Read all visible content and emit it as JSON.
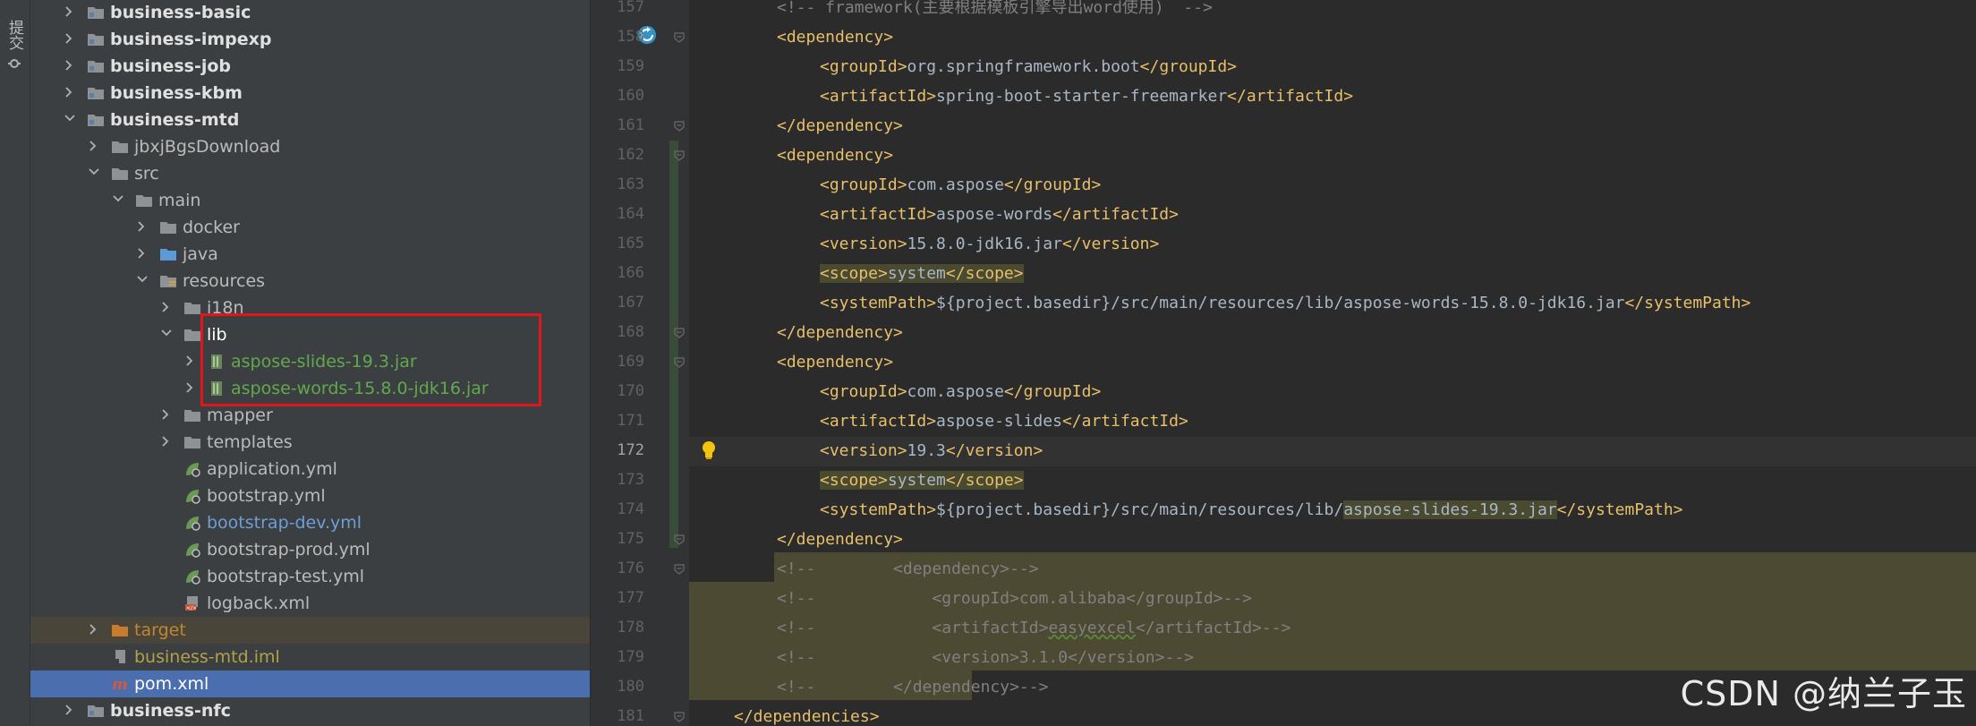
{
  "side_panel": {
    "commit_label": "提交"
  },
  "tree": [
    {
      "label": "business-basic",
      "style": "bold",
      "depth": 0,
      "arrow": "right",
      "icon": "module"
    },
    {
      "label": "business-impexp",
      "style": "bold",
      "depth": 0,
      "arrow": "right",
      "icon": "module"
    },
    {
      "label": "business-job",
      "style": "bold",
      "depth": 0,
      "arrow": "right",
      "icon": "module"
    },
    {
      "label": "business-kbm",
      "style": "bold",
      "depth": 0,
      "arrow": "right",
      "icon": "module"
    },
    {
      "label": "business-mtd",
      "style": "bold",
      "depth": 0,
      "arrow": "down",
      "icon": "module"
    },
    {
      "label": "jbxjBgsDownload",
      "style": "normal",
      "depth": 1,
      "arrow": "right",
      "icon": "folder"
    },
    {
      "label": "src",
      "style": "normal",
      "depth": 1,
      "arrow": "down",
      "icon": "folder"
    },
    {
      "label": "main",
      "style": "normal",
      "depth": 2,
      "arrow": "down",
      "icon": "folder"
    },
    {
      "label": "docker",
      "style": "normal",
      "depth": 3,
      "arrow": "right",
      "icon": "folder"
    },
    {
      "label": "java",
      "style": "normal",
      "depth": 3,
      "arrow": "right",
      "icon": "folder-blue"
    },
    {
      "label": "resources",
      "style": "normal",
      "depth": 3,
      "arrow": "down",
      "icon": "folder-res"
    },
    {
      "label": "i18n",
      "style": "normal",
      "depth": 4,
      "arrow": "right",
      "icon": "folder"
    },
    {
      "label": "lib",
      "style": "white",
      "depth": 4,
      "arrow": "down",
      "icon": "folder"
    },
    {
      "label": "aspose-slides-19.3.jar",
      "style": "green",
      "depth": 5,
      "arrow": "right",
      "icon": "jar"
    },
    {
      "label": "aspose-words-15.8.0-jdk16.jar",
      "style": "green",
      "depth": 5,
      "arrow": "right",
      "icon": "jar"
    },
    {
      "label": "mapper",
      "style": "normal",
      "depth": 4,
      "arrow": "right",
      "icon": "folder"
    },
    {
      "label": "templates",
      "style": "normal",
      "depth": 4,
      "arrow": "right",
      "icon": "folder"
    },
    {
      "label": "application.yml",
      "style": "normal",
      "depth": 4,
      "arrow": "none",
      "icon": "yml"
    },
    {
      "label": "bootstrap.yml",
      "style": "normal",
      "depth": 4,
      "arrow": "none",
      "icon": "yml"
    },
    {
      "label": "bootstrap-dev.yml",
      "style": "blue",
      "depth": 4,
      "arrow": "none",
      "icon": "yml"
    },
    {
      "label": "bootstrap-prod.yml",
      "style": "normal",
      "depth": 4,
      "arrow": "none",
      "icon": "yml"
    },
    {
      "label": "bootstrap-test.yml",
      "style": "normal",
      "depth": 4,
      "arrow": "none",
      "icon": "yml"
    },
    {
      "label": "logback.xml",
      "style": "normal",
      "depth": 4,
      "arrow": "none",
      "icon": "xml"
    },
    {
      "label": "target",
      "style": "orange",
      "depth": 1,
      "arrow": "right",
      "icon": "folder-orange",
      "selected": "orange"
    },
    {
      "label": "business-mtd.iml",
      "style": "olive",
      "depth": 1,
      "arrow": "none",
      "icon": "iml"
    },
    {
      "label": "pom.xml",
      "style": "white",
      "depth": 1,
      "arrow": "none",
      "icon": "maven",
      "selected": "blue"
    },
    {
      "label": "business-nfc",
      "style": "bold",
      "depth": 0,
      "arrow": "right",
      "icon": "module"
    }
  ],
  "editor": {
    "current_line": "172",
    "lines": [
      {
        "n": "157",
        "segs": [
          {
            "k": "c",
            "t": "<!-- framework(主要根据模板引擎导出word使用)  -->"
          }
        ],
        "indent": 1
      },
      {
        "n": "158",
        "segs": [
          {
            "k": "t",
            "t": "<dependency>"
          }
        ],
        "indent": 1
      },
      {
        "n": "159",
        "segs": [
          {
            "k": "t",
            "t": "<groupId>"
          },
          {
            "k": "x",
            "t": "org.springframework.boot"
          },
          {
            "k": "t",
            "t": "</groupId>"
          }
        ],
        "indent": 2
      },
      {
        "n": "160",
        "segs": [
          {
            "k": "t",
            "t": "<artifactId>"
          },
          {
            "k": "x",
            "t": "spring-boot-starter-freemarker"
          },
          {
            "k": "t",
            "t": "</artifactId>"
          }
        ],
        "indent": 2
      },
      {
        "n": "161",
        "segs": [
          {
            "k": "t",
            "t": "</dependency>"
          }
        ],
        "indent": 1
      },
      {
        "n": "162",
        "segs": [
          {
            "k": "t",
            "t": "<dependency>"
          }
        ],
        "indent": 1
      },
      {
        "n": "163",
        "segs": [
          {
            "k": "t",
            "t": "<groupId>"
          },
          {
            "k": "x",
            "t": "com.aspose"
          },
          {
            "k": "t",
            "t": "</groupId>"
          }
        ],
        "indent": 2
      },
      {
        "n": "164",
        "segs": [
          {
            "k": "t",
            "t": "<artifactId>"
          },
          {
            "k": "x",
            "t": "aspose-words"
          },
          {
            "k": "t",
            "t": "</artifactId>"
          }
        ],
        "indent": 2
      },
      {
        "n": "165",
        "segs": [
          {
            "k": "t",
            "t": "<version>"
          },
          {
            "k": "x",
            "t": "15.8.0-jdk16.jar"
          },
          {
            "k": "t",
            "t": "</version>"
          }
        ],
        "indent": 2
      },
      {
        "n": "166",
        "segs": [
          {
            "k": "th",
            "t": "<scope>"
          },
          {
            "k": "xh",
            "t": "system"
          },
          {
            "k": "th",
            "t": "</scope>"
          }
        ],
        "indent": 2
      },
      {
        "n": "167",
        "segs": [
          {
            "k": "t",
            "t": "<systemPath>"
          },
          {
            "k": "x",
            "t": "${project.basedir}/src/main/resources/lib/aspose-words-15.8.0-jdk16.jar"
          },
          {
            "k": "t",
            "t": "</systemPath>"
          }
        ],
        "indent": 2
      },
      {
        "n": "168",
        "segs": [
          {
            "k": "t",
            "t": "</dependency>"
          }
        ],
        "indent": 1
      },
      {
        "n": "169",
        "segs": [
          {
            "k": "t",
            "t": "<dependency>"
          }
        ],
        "indent": 1
      },
      {
        "n": "170",
        "segs": [
          {
            "k": "t",
            "t": "<groupId>"
          },
          {
            "k": "x",
            "t": "com.aspose"
          },
          {
            "k": "t",
            "t": "</groupId>"
          }
        ],
        "indent": 2
      },
      {
        "n": "171",
        "segs": [
          {
            "k": "t",
            "t": "<artifactId>"
          },
          {
            "k": "x",
            "t": "aspose-slides"
          },
          {
            "k": "t",
            "t": "</artifactId>"
          }
        ],
        "indent": 2
      },
      {
        "n": "172",
        "segs": [
          {
            "k": "t",
            "t": "<version>"
          },
          {
            "k": "x",
            "t": "19.3"
          },
          {
            "k": "t",
            "t": "</version>"
          }
        ],
        "indent": 2
      },
      {
        "n": "173",
        "segs": [
          {
            "k": "th",
            "t": "<scope>"
          },
          {
            "k": "xh",
            "t": "system"
          },
          {
            "k": "th",
            "t": "</scope>"
          }
        ],
        "indent": 2
      },
      {
        "n": "174",
        "segs": [
          {
            "k": "t",
            "t": "<systemPath>"
          },
          {
            "k": "x",
            "t": "${project.basedir}/src/main/resources/lib/"
          },
          {
            "k": "xh",
            "t": "aspose-slides-19.3.jar"
          },
          {
            "k": "t",
            "t": "</systemPath>"
          }
        ],
        "indent": 2
      },
      {
        "n": "175",
        "segs": [
          {
            "k": "t",
            "t": "</dependency>"
          }
        ],
        "indent": 1
      },
      {
        "n": "176",
        "segs": [
          {
            "k": "c",
            "t": "<!--        <dependency>-->"
          }
        ],
        "indent": 1
      },
      {
        "n": "177",
        "segs": [
          {
            "k": "c",
            "t": "<!--            <groupId>com.alibaba</groupId>-->"
          }
        ],
        "indent": 1
      },
      {
        "n": "178",
        "segs": [
          {
            "k": "c",
            "t": "<!--            <artifactId>"
          },
          {
            "k": "cw",
            "t": "easyexcel"
          },
          {
            "k": "c",
            "t": "</artifactId>-->"
          }
        ],
        "indent": 1
      },
      {
        "n": "179",
        "segs": [
          {
            "k": "c",
            "t": "<!--            <version>3.1.0</version>-->"
          }
        ],
        "indent": 1
      },
      {
        "n": "180",
        "segs": [
          {
            "k": "c",
            "t": "<!--        </dependency>-->"
          }
        ],
        "indent": 1
      },
      {
        "n": "181",
        "segs": [
          {
            "k": "t",
            "t": "</dependencies>"
          }
        ],
        "indent": 0
      }
    ]
  },
  "watermark": "CSDN @纳兰子玉"
}
